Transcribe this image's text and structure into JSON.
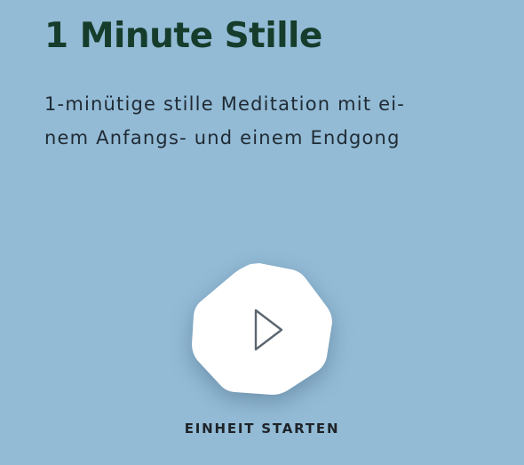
{
  "session": {
    "title": "1 Minute Stille",
    "description_lines": [
      "1-minütige stille Meditation mit ei-",
      "nem Anfangs- und einem Endgong"
    ]
  },
  "player": {
    "play_icon": "play-icon",
    "start_label": "EINHEIT STARTEN"
  },
  "colors": {
    "background": "#93bbd6",
    "title": "#163d2b",
    "text": "#1f2a33",
    "button_fill": "#ffffff",
    "icon_stroke": "#5b6670"
  }
}
